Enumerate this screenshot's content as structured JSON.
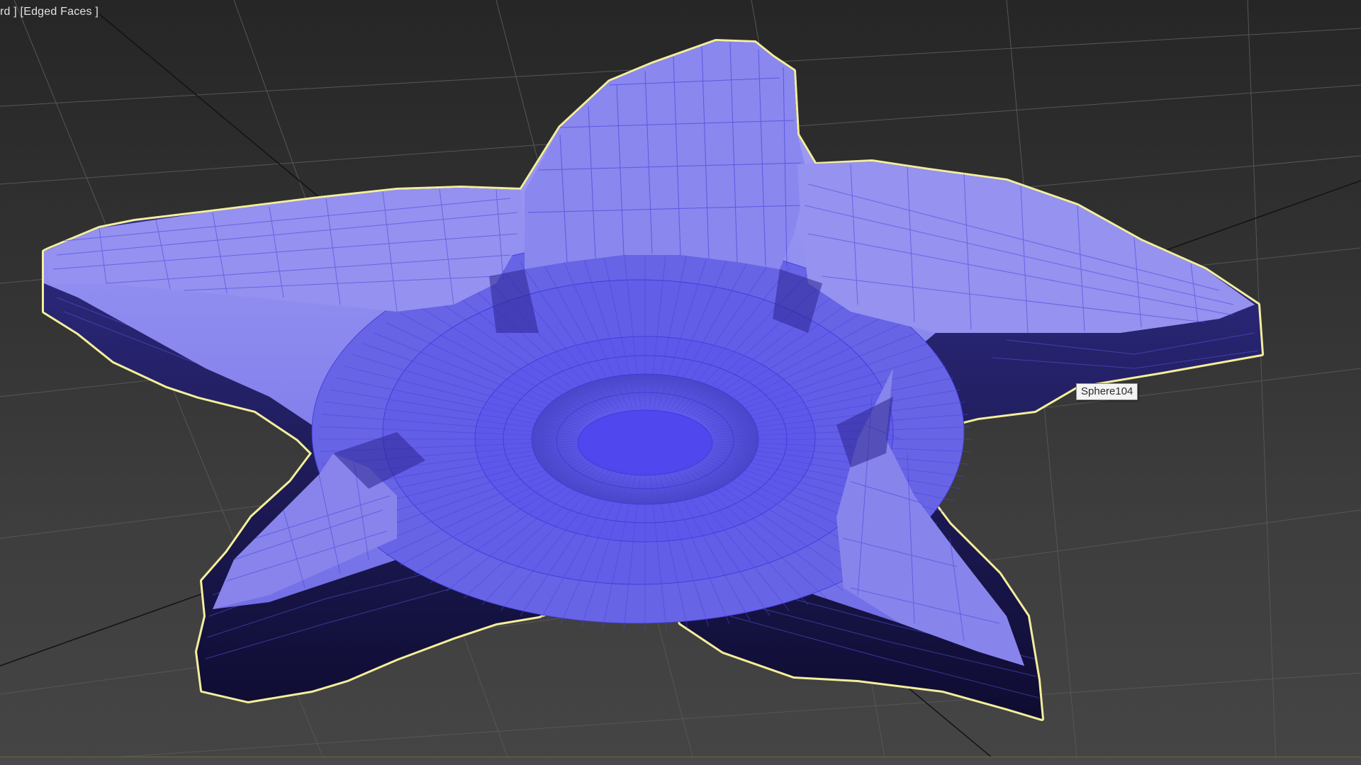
{
  "viewport": {
    "label": "rd ] [Edged Faces ]",
    "tooltip": "Sphere104"
  },
  "colors": {
    "background": "#323232",
    "grid": "#555555",
    "object": "#7b78ee",
    "wireframe": "#3d38d8",
    "selection": "#f4ef9a",
    "shadow": "#12103c"
  },
  "icons": {
    "object": "star-mesh-icon"
  }
}
